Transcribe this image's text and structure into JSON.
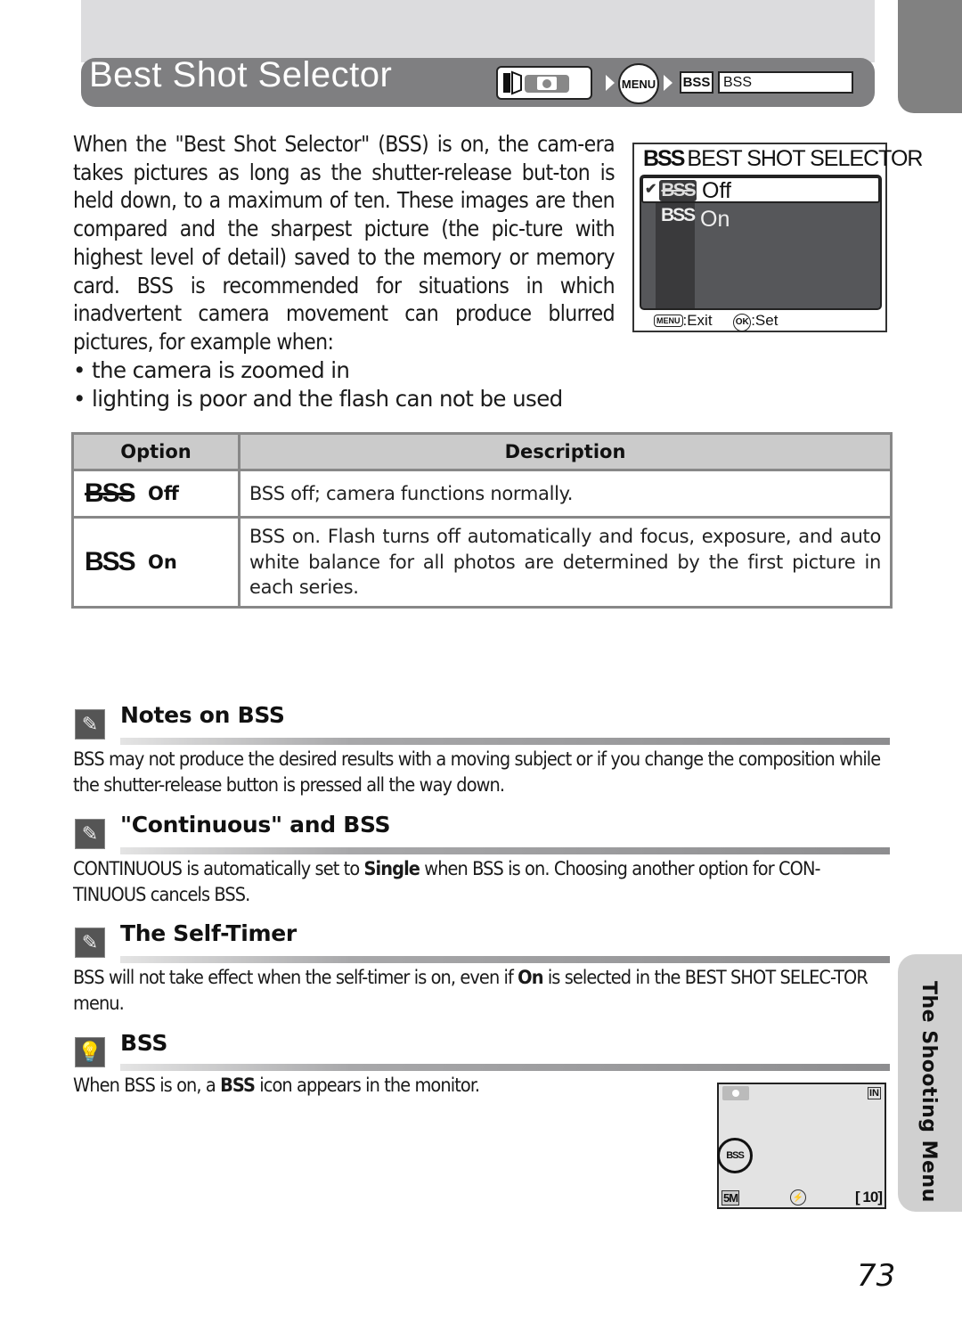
{
  "header": {
    "title": "Best Shot Selector",
    "breadcrumb": {
      "mode_icon": "shooting-mode-camera-icon",
      "menu_button": "MENU",
      "bss_tag": "BSS",
      "bss_item": "BSS"
    }
  },
  "intro": {
    "paragraph": "When the \"Best Shot Selector\" (BSS) is on, the cam-era takes pictures as long as the shutter-release but-ton is held down, to a maximum of ten. These images are then compared and the sharpest picture (the pic-ture with highest level of detail) saved to the memory or memory card. BSS is recommended for situations in which inadvertent camera movement can produce blurred pictures, for example when:",
    "bullets": [
      "the camera is zoomed in",
      "lighting is poor and the flash can not be used"
    ]
  },
  "camera_menu": {
    "title_icon": "BSS",
    "title": "BEST SHOT SELECTOR",
    "items": [
      {
        "icon": "BSS",
        "label": "Off",
        "selected": true,
        "checked": true
      },
      {
        "icon": "BSS",
        "label": "On",
        "selected": false,
        "checked": false
      }
    ],
    "footer": {
      "exit_key": "MENU",
      "exit_label": ":Exit",
      "set_key": "OK",
      "set_label": ":Set"
    }
  },
  "options_table": {
    "headers": [
      "Option",
      "Description"
    ],
    "rows": [
      {
        "icon": "BSS",
        "icon_state": "off",
        "option": "Off",
        "description": "BSS off; camera functions normally."
      },
      {
        "icon": "BSS",
        "icon_state": "on",
        "option": "On",
        "description": "BSS on. Flash turns off automatically and focus, exposure, and auto white balance for all photos are determined by the first picture in each series."
      }
    ]
  },
  "notes": [
    {
      "icon": "paperclip-note-icon",
      "title": "Notes on BSS",
      "body_parts": [
        {
          "text": "BSS may not produce the desired results with a moving subject or if you change the composition while the shutter-release button is pressed all the way down.",
          "bold": false
        }
      ]
    },
    {
      "icon": "paperclip-note-icon",
      "title": "\"Continuous\" and BSS",
      "body_parts": [
        {
          "text": "CONTINUOUS is automatically set to ",
          "bold": false
        },
        {
          "text": "Single",
          "bold": true
        },
        {
          "text": " when BSS is on. Choosing another option for CON-TINUOUS cancels BSS.",
          "bold": false
        }
      ]
    },
    {
      "icon": "paperclip-note-icon",
      "title": "The Self-Timer",
      "body_parts": [
        {
          "text": "BSS will not take effect when the self-timer is on, even if ",
          "bold": false
        },
        {
          "text": "On",
          "bold": true
        },
        {
          "text": " is selected in the BEST SHOT SELEC-TOR menu.",
          "bold": false
        }
      ]
    },
    {
      "icon": "lightbulb-tip-icon",
      "title": "BSS",
      "body_parts": [
        {
          "text": "When BSS is on, a ",
          "bold": false
        },
        {
          "text": "BSS",
          "bold": true
        },
        {
          "text": " icon appears in the monitor.",
          "bold": false
        }
      ]
    }
  ],
  "monitor": {
    "mode_icon": "camera-icon",
    "memory_indicator": "IN",
    "bss_indicator": "BSS",
    "image_size": "5M",
    "flash_indicator": "flash-off-icon",
    "exposures_remaining": "[ 10]"
  },
  "side_tab": {
    "label": "The Shooting Menu"
  },
  "page_number": "73"
}
